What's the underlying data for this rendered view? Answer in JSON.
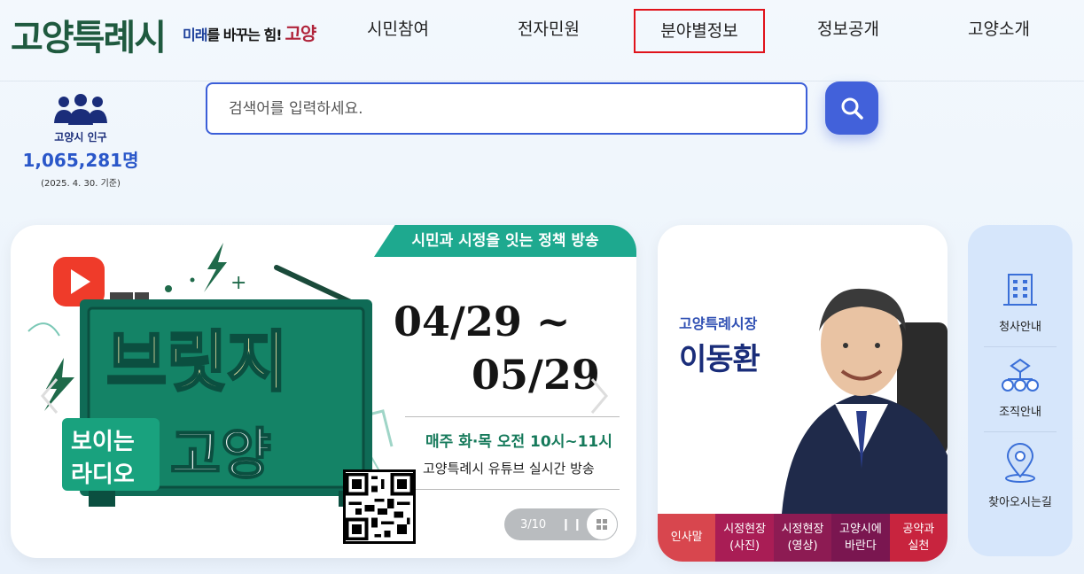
{
  "header": {
    "logo": "고양특례시",
    "slogan": {
      "part1": "미래",
      "part2": "를 바꾸는 힘!",
      "part3": "고양"
    },
    "nav": [
      {
        "label": "시민참여",
        "active": false
      },
      {
        "label": "전자민원",
        "active": false
      },
      {
        "label": "분야별정보",
        "active": true
      },
      {
        "label": "정보공개",
        "active": false
      },
      {
        "label": "고양소개",
        "active": false
      }
    ]
  },
  "population": {
    "label": "고양시 인구",
    "value": "1,065,281명",
    "date": "(2025. 4. 30. 기준)",
    "icon": "people-icon"
  },
  "search": {
    "placeholder": "검색어를 입력하세요.",
    "button_icon": "search-icon"
  },
  "banner": {
    "ribbon": "시민과 시정을 잇는 정책 방송",
    "art_title_top": "브릿지",
    "art_title_sub1": "보이는",
    "art_title_sub2": "라디오",
    "art_title_main": "고양",
    "date_start": "04/29 ~",
    "date_end": "05/29",
    "schedule": "매주 화·목  오전 10시~11시",
    "subtitle": "고양특례시 유튜브 실시간 방송",
    "pager": {
      "current": "3/10",
      "pause": "❙❙"
    }
  },
  "mayor": {
    "title": "고양특례시장",
    "name": "이동환",
    "tabs": [
      {
        "label": "인사말",
        "color": "#d8464e"
      },
      {
        "label": "시정현장\n(사진)",
        "color": "#a91d55"
      },
      {
        "label": "시정현장\n(영상)",
        "color": "#8d1b53"
      },
      {
        "label": "고양시에\n바란다",
        "color": "#7a1650"
      },
      {
        "label": "공약과\n실천",
        "color": "#c8243e"
      }
    ]
  },
  "quick_menu": [
    {
      "label": "청사안내",
      "icon": "building-icon"
    },
    {
      "label": "조직안내",
      "icon": "org-chart-icon"
    },
    {
      "label": "찾아오시는길",
      "icon": "location-pin-icon"
    }
  ],
  "colors": {
    "accent": "#4261da",
    "brand_green": "#1f5a3f",
    "ribbon_teal": "#1ea98f",
    "nav_active_border": "#e0131b"
  }
}
